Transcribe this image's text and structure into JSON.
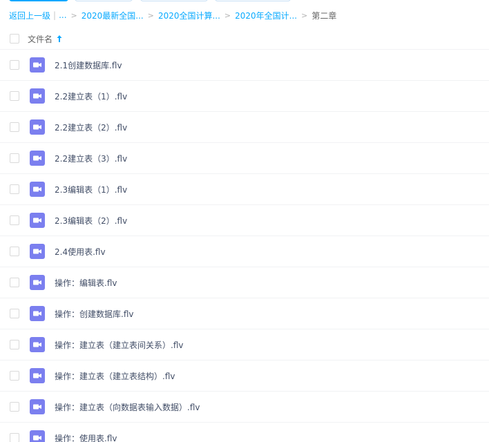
{
  "breadcrumb": {
    "back_label": "返回上一级",
    "ellipsis_label": "...",
    "separator": ">",
    "items": [
      {
        "label": "2020最新全国..."
      },
      {
        "label": "2020全国计算..."
      },
      {
        "label": "2020年全国计..."
      }
    ],
    "current": "第二章"
  },
  "list_header": {
    "name_label": "文件名",
    "sort_direction": "ascending"
  },
  "files": [
    {
      "name": "2.1创建数据库.flv",
      "icon": "video-file-icon"
    },
    {
      "name": "2.2建立表（1）.flv",
      "icon": "video-file-icon"
    },
    {
      "name": "2.2建立表（2）.flv",
      "icon": "video-file-icon"
    },
    {
      "name": "2.2建立表（3）.flv",
      "icon": "video-file-icon"
    },
    {
      "name": "2.3编辑表（1）.flv",
      "icon": "video-file-icon"
    },
    {
      "name": "2.3编辑表（2）.flv",
      "icon": "video-file-icon"
    },
    {
      "name": "2.4使用表.flv",
      "icon": "video-file-icon"
    },
    {
      "name": "操作：编辑表.flv",
      "icon": "video-file-icon"
    },
    {
      "name": "操作：创建数据库.flv",
      "icon": "video-file-icon"
    },
    {
      "name": "操作：建立表（建立表间关系）.flv",
      "icon": "video-file-icon"
    },
    {
      "name": "操作：建立表（建立表结构）.flv",
      "icon": "video-file-icon"
    },
    {
      "name": "操作：建立表（向数据表输入数据）.flv",
      "icon": "video-file-icon"
    },
    {
      "name": "操作：使用表.flv",
      "icon": "video-file-icon"
    }
  ],
  "colors": {
    "accent": "#06a7ff",
    "link": "#09aaff",
    "video_icon": "#7b7fef"
  }
}
